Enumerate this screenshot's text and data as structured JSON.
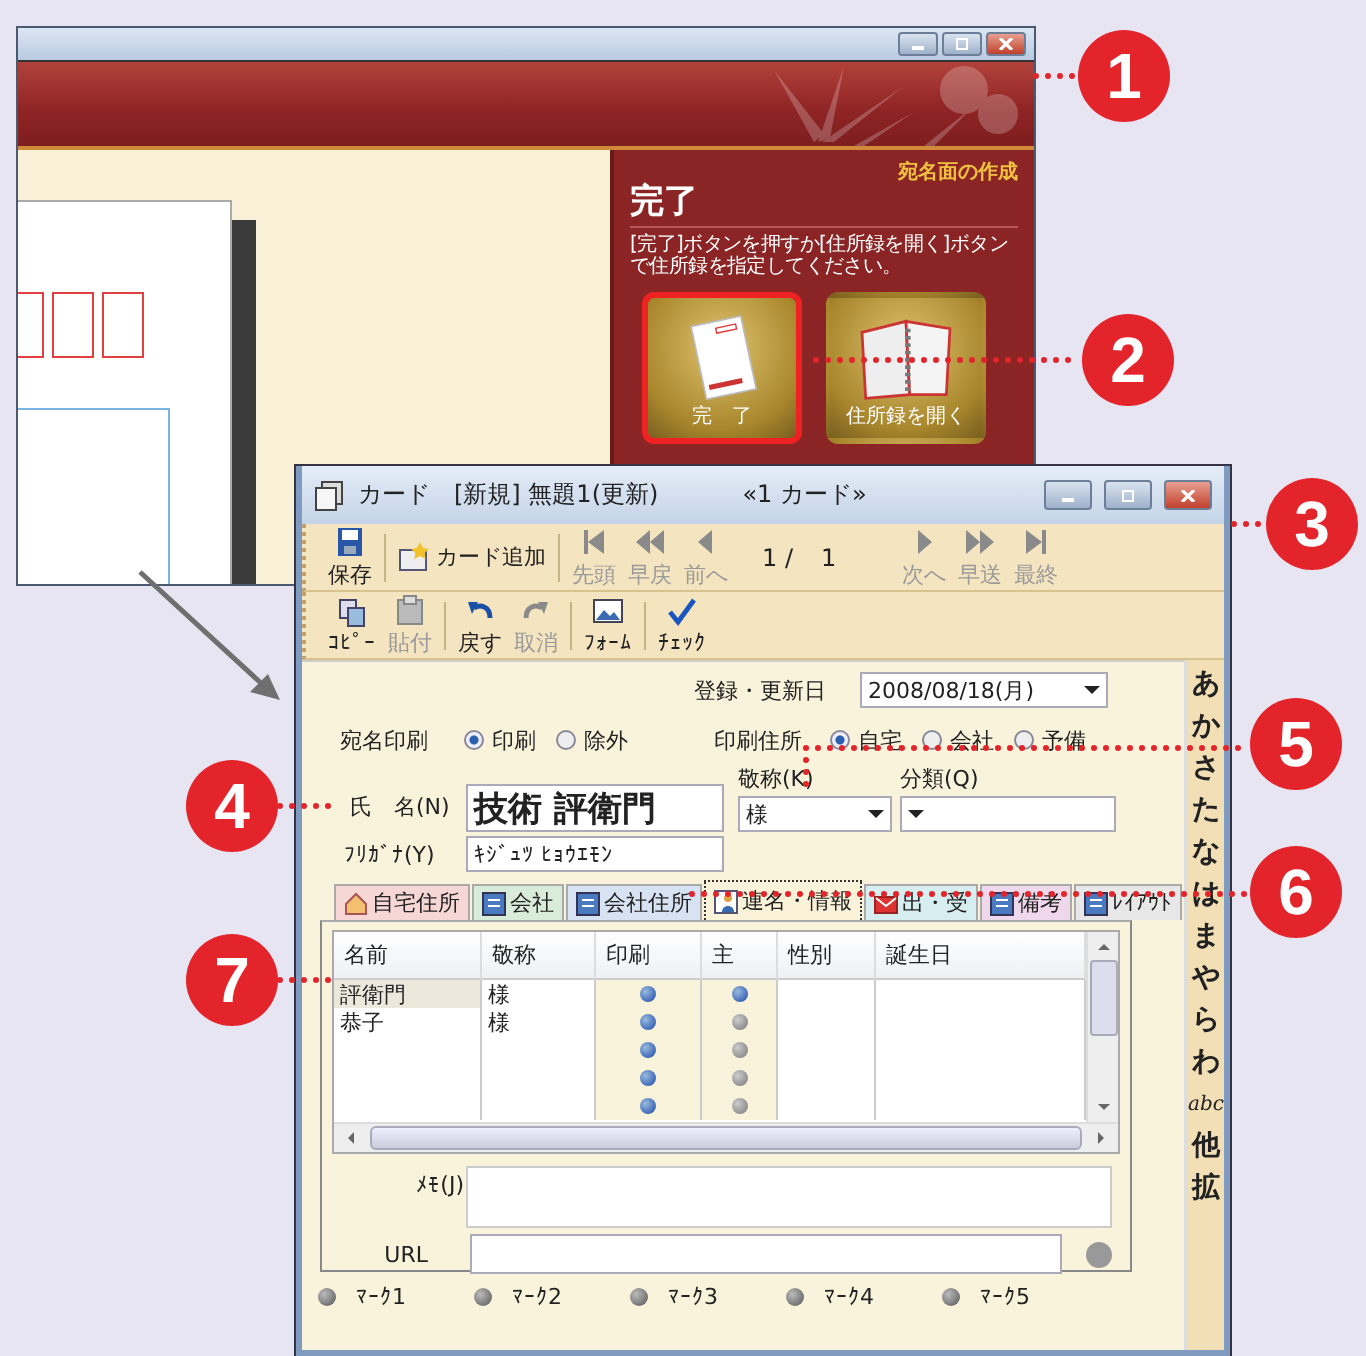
{
  "back_window": {
    "banner_heading": "宛名面の作成",
    "title": "完了",
    "message": "[完了]ボタンを押すか[住所録を開く]ボタンで住所録を指定してください。",
    "buttons": [
      {
        "label": "完　了",
        "kind": "postcard",
        "selected": true
      },
      {
        "label": "住所録を開く",
        "kind": "notebook",
        "selected": false
      }
    ]
  },
  "card_window": {
    "title": "カード　[新規] 無題1(更新)",
    "count": "«1 カード»",
    "toolbar": [
      {
        "label": "保存",
        "kind": "save",
        "disabled": false
      },
      {
        "label": "カード追加",
        "kind": "add",
        "disabled": false
      },
      {
        "label": "先頭",
        "kind": "first",
        "disabled": true
      },
      {
        "label": "早戻",
        "kind": "rewind",
        "disabled": true
      },
      {
        "label": "前へ",
        "kind": "prev",
        "disabled": true
      },
      {
        "label": "1 /",
        "kind": "page"
      },
      {
        "label": "1",
        "kind": "total"
      },
      {
        "label": "次へ",
        "kind": "next",
        "disabled": true
      },
      {
        "label": "早送",
        "kind": "forward",
        "disabled": true
      },
      {
        "label": "最終",
        "kind": "last",
        "disabled": true
      }
    ],
    "toolbar_2": [
      {
        "label": "ｺﾋﾟｰ",
        "kind": "copy",
        "disabled": false
      },
      {
        "label": "貼付",
        "kind": "paste",
        "disabled": true
      },
      {
        "label": "戻す",
        "kind": "undo",
        "disabled": false
      },
      {
        "label": "取消",
        "kind": "redo",
        "disabled": true
      },
      {
        "label": "ﾌｫｰﾑ",
        "kind": "form",
        "disabled": false
      },
      {
        "label": "ﾁｪｯｸ",
        "kind": "check",
        "disabled": false
      }
    ],
    "date": {
      "label": "登録・更新日",
      "value": "2008/08/18(月)"
    },
    "print_name": {
      "label": "宛名印刷",
      "options": [
        {
          "label": "印刷",
          "selected": true
        },
        {
          "label": "除外",
          "selected": false
        }
      ]
    },
    "print_address": {
      "label": "印刷住所",
      "options": [
        {
          "label": "自宅",
          "selected": true
        },
        {
          "label": "会社",
          "selected": false
        },
        {
          "label": "予備",
          "selected": false
        }
      ]
    },
    "name": {
      "label": "氏　名(N)",
      "value": "技術 評衛門"
    },
    "honorific": {
      "label": "敬称(K)",
      "value": "様"
    },
    "category": {
      "label": "分類(Q)"
    },
    "furigana": {
      "label": "ﾌﾘｶﾞﾅ(Y)",
      "value": "ｷｼﾞｭﾂ ﾋｮｳｴﾓﾝ"
    },
    "tabs": [
      {
        "label": "自宅住所",
        "kind": "house",
        "color": "#f7d6d6",
        "selected": false
      },
      {
        "label": "会社",
        "kind": "card",
        "color": "#d9ecd9",
        "selected": false
      },
      {
        "label": "会社住所",
        "kind": "card",
        "color": "#d7e3f3",
        "selected": false
      },
      {
        "label": "連名・情報",
        "kind": "person",
        "color": "#fbf3d9",
        "selected": true
      },
      {
        "label": "出・受",
        "kind": "mail",
        "color": "#d6eef0",
        "selected": false
      },
      {
        "label": "備考",
        "kind": "card",
        "color": "#f0d8ec",
        "selected": false
      },
      {
        "label": "ﾚｲｱｳﾄ",
        "kind": "card",
        "color": "#e8e8e8",
        "selected": false
      }
    ],
    "table": {
      "columns": [
        "名前",
        "敬称",
        "印刷",
        "主",
        "性別",
        "誕生日"
      ],
      "rows": [
        {
          "name": "評衛門",
          "honorific": "様",
          "print": true,
          "main": true,
          "selected": true
        },
        {
          "name": "恭子",
          "honorific": "様",
          "print": true,
          "main": false,
          "selected": false
        },
        {
          "print": true,
          "main": false,
          "selected": false
        },
        {
          "print": true,
          "main": false,
          "selected": false
        },
        {
          "print": true,
          "main": false,
          "selected": false
        }
      ]
    },
    "memo": {
      "label": "ﾒﾓ(J)"
    },
    "url": {
      "label": "URL"
    },
    "marks": [
      {
        "label": "ﾏｰｸ1",
        "on": false
      },
      {
        "label": "ﾏｰｸ2",
        "on": false
      },
      {
        "label": "ﾏｰｸ3",
        "on": false
      },
      {
        "label": "ﾏｰｸ4",
        "on": false
      },
      {
        "label": "ﾏｰｸ5",
        "on": false
      }
    ],
    "index": [
      "あ",
      "か",
      "さ",
      "た",
      "な",
      "は",
      "ま",
      "や",
      "ら",
      "わ",
      "abc",
      "他",
      "拡"
    ]
  },
  "callouts": [
    {
      "number": "1"
    },
    {
      "number": "2"
    },
    {
      "number": "3"
    },
    {
      "number": "4"
    },
    {
      "number": "5"
    },
    {
      "number": "6"
    },
    {
      "number": "7"
    }
  ]
}
